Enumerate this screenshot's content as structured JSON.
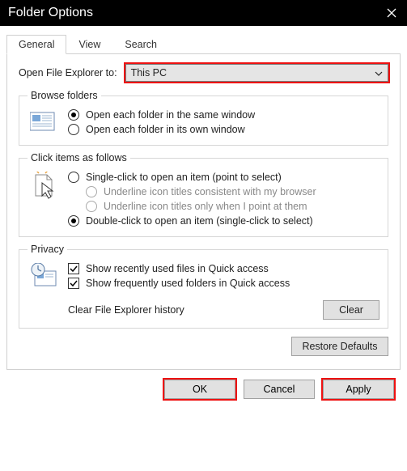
{
  "titlebar": {
    "title": "Folder Options"
  },
  "tabs": {
    "general": "General",
    "view": "View",
    "search": "Search"
  },
  "open_explorer": {
    "label": "Open File Explorer to:",
    "value": "This PC"
  },
  "browse_folders": {
    "legend": "Browse folders",
    "opt_same": "Open each folder in the same window",
    "opt_own": "Open each folder in its own window"
  },
  "click_items": {
    "legend": "Click items as follows",
    "single": "Single-click to open an item (point to select)",
    "underline_browser": "Underline icon titles consistent with my browser",
    "underline_point": "Underline icon titles only when I point at them",
    "double": "Double-click to open an item (single-click to select)"
  },
  "privacy": {
    "legend": "Privacy",
    "recent_files": "Show recently used files in Quick access",
    "freq_folders": "Show frequently used folders in Quick access",
    "clear_label": "Clear File Explorer history",
    "clear_btn": "Clear"
  },
  "restore_btn": "Restore Defaults",
  "footer": {
    "ok": "OK",
    "cancel": "Cancel",
    "apply": "Apply"
  }
}
